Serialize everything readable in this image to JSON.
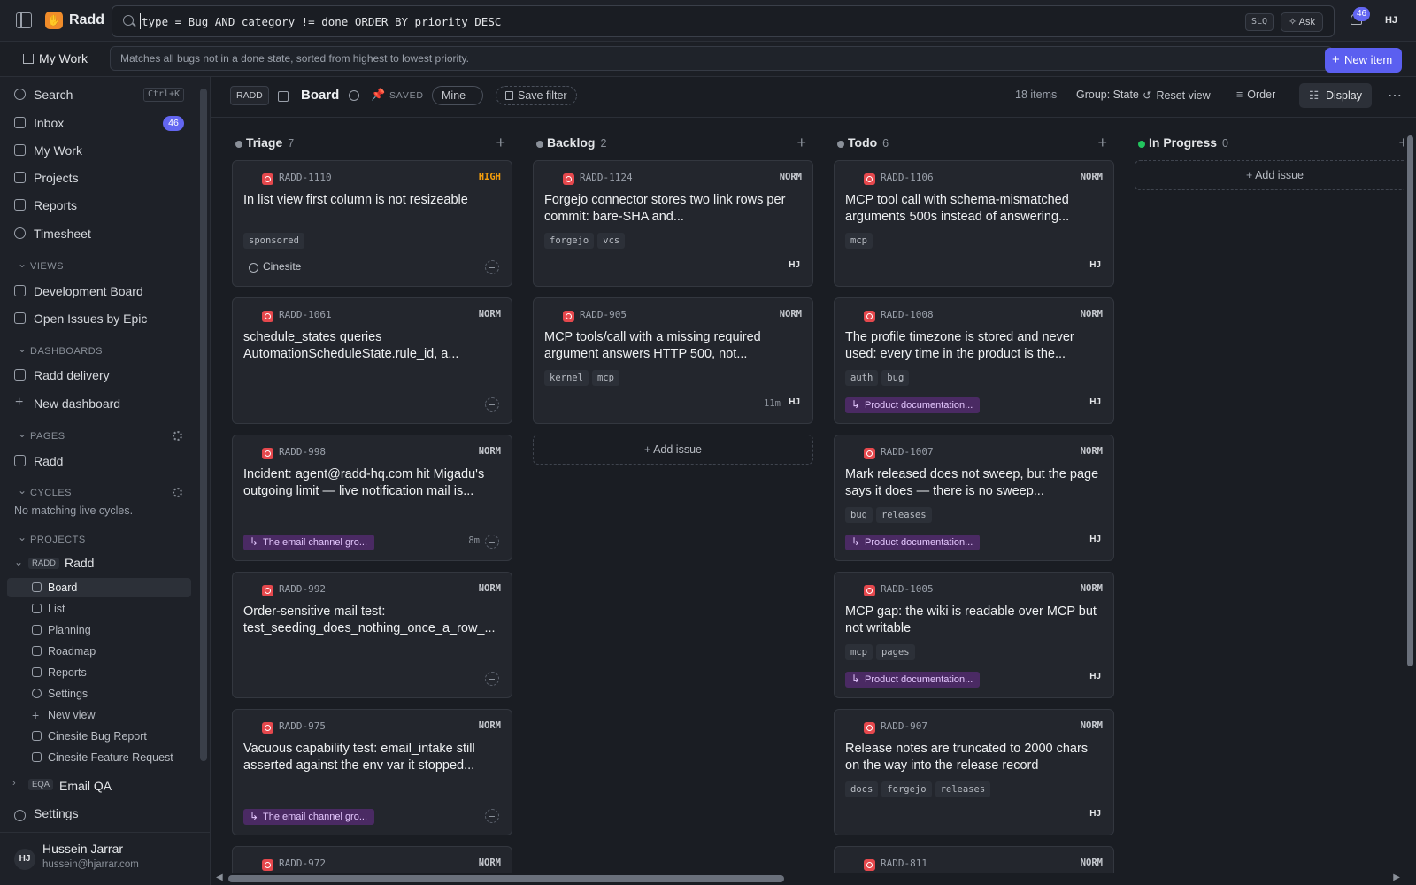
{
  "app": {
    "name": "Radd",
    "logo_icon": "radd-logo-icon"
  },
  "query": {
    "text": "type = Bug AND category != done ORDER BY priority DESC",
    "mode_badge": "SLQ",
    "ask_label": "Ask",
    "hint": "Matches all bugs not in a done state, sorted from highest to lowest priority."
  },
  "notifications": {
    "count": "46"
  },
  "user": {
    "initials": "HJ",
    "name": "Hussein Jarrar",
    "email": "hussein@hjarrar.com"
  },
  "topnav": {
    "my_work": "My Work",
    "new_item": "New item"
  },
  "sidebar": {
    "search": "Search",
    "search_shortcut": "Ctrl+K",
    "inbox": "Inbox",
    "inbox_count": "46",
    "my_work": "My Work",
    "projects": "Projects",
    "reports": "Reports",
    "timesheet": "Timesheet",
    "views_heading": "VIEWS",
    "views": [
      "Development Board",
      "Open Issues by Epic"
    ],
    "dashboards_heading": "DASHBOARDS",
    "dashboards": [
      "Radd delivery",
      "New dashboard"
    ],
    "pages_heading": "PAGES",
    "pages": [
      "Radd"
    ],
    "cycles_heading": "CYCLES",
    "cycles_empty": "No matching live cycles.",
    "projects_heading": "PROJECTS",
    "project": {
      "code": "RADD",
      "name": "Radd"
    },
    "project_items": [
      "Board",
      "List",
      "Planning",
      "Roadmap",
      "Reports",
      "Settings",
      "New view",
      "Cinesite Bug Report",
      "Cinesite Feature Request"
    ],
    "project2": {
      "code": "EQA",
      "name": "Email QA"
    },
    "settings": "Settings"
  },
  "viewbar": {
    "project_chip": "RADD",
    "title": "Board",
    "saved": "SAVED",
    "mine": "Mine",
    "save_filter": "Save filter",
    "items": "18 items",
    "group": "Group: State",
    "reset": "Reset view",
    "order": "Order",
    "display": "Display"
  },
  "columns": [
    {
      "name": "Triage",
      "count": "7"
    },
    {
      "name": "Backlog",
      "count": "2"
    },
    {
      "name": "Todo",
      "count": "6"
    },
    {
      "name": "In Progress",
      "count": "0"
    }
  ],
  "add_issue": "Add issue",
  "cards": {
    "triage": [
      {
        "id": "RADD-1110",
        "prio": "HIGH",
        "title": "In list view first column is not resizeable",
        "tags": [
          "sponsored"
        ],
        "customer": "Cinesite"
      },
      {
        "id": "RADD-1061",
        "prio": "NORM",
        "title": "schedule_states queries AutomationScheduleState.rule_id, a...",
        "tags": []
      },
      {
        "id": "RADD-998",
        "prio": "NORM",
        "title": "Incident: agent@radd-hq.com hit Migadu's outgoing limit — live notification mail is...",
        "tags": [],
        "epic": "The email channel gro...",
        "age": "8m"
      },
      {
        "id": "RADD-992",
        "prio": "NORM",
        "title": "Order-sensitive mail test: test_seeding_does_nothing_once_a_row_...",
        "tags": []
      },
      {
        "id": "RADD-975",
        "prio": "NORM",
        "title": "Vacuous capability test: email_intake still asserted against the env var it stopped...",
        "tags": [],
        "epic": "The email channel gro..."
      },
      {
        "id": "RADD-972",
        "prio": "NORM"
      }
    ],
    "backlog": [
      {
        "id": "RADD-1124",
        "prio": "NORM",
        "title": "Forgejo connector stores two link rows per commit: bare-SHA and...",
        "tags": [
          "forgejo",
          "vcs"
        ],
        "assignee": "HJ"
      },
      {
        "id": "RADD-905",
        "prio": "NORM",
        "title": "MCP tools/call with a missing required argument answers HTTP 500, not...",
        "tags": [
          "kernel",
          "mcp"
        ],
        "age": "11m",
        "assignee": "HJ"
      }
    ],
    "todo": [
      {
        "id": "RADD-1106",
        "prio": "NORM",
        "title": "MCP tool call with schema-mismatched arguments 500s instead of answering...",
        "tags": [
          "mcp"
        ],
        "assignee": "HJ"
      },
      {
        "id": "RADD-1008",
        "prio": "NORM",
        "title": "The profile timezone is stored and never used: every time in the product is the...",
        "tags": [
          "auth",
          "bug"
        ],
        "epic": "Product documentation...",
        "assignee": "HJ"
      },
      {
        "id": "RADD-1007",
        "prio": "NORM",
        "title": "Mark released does not sweep, but the page says it does — there is no sweep...",
        "tags": [
          "bug",
          "releases"
        ],
        "epic": "Product documentation...",
        "assignee": "HJ"
      },
      {
        "id": "RADD-1005",
        "prio": "NORM",
        "title": "MCP gap: the wiki is readable over MCP but not writable",
        "tags": [
          "mcp",
          "pages"
        ],
        "epic": "Product documentation...",
        "assignee": "HJ"
      },
      {
        "id": "RADD-907",
        "prio": "NORM",
        "title": "Release notes are truncated to 2000 chars on the way into the release record",
        "tags": [
          "docs",
          "forgejo",
          "releases"
        ],
        "assignee": "HJ"
      },
      {
        "id": "RADD-811",
        "prio": "NORM"
      }
    ]
  },
  "colors": {
    "accent": "#5b5ff0",
    "bug": "#e5484d",
    "high": "#f59e0b",
    "epic_bg": "#4a2a63",
    "in_progress": "#22c55e"
  }
}
